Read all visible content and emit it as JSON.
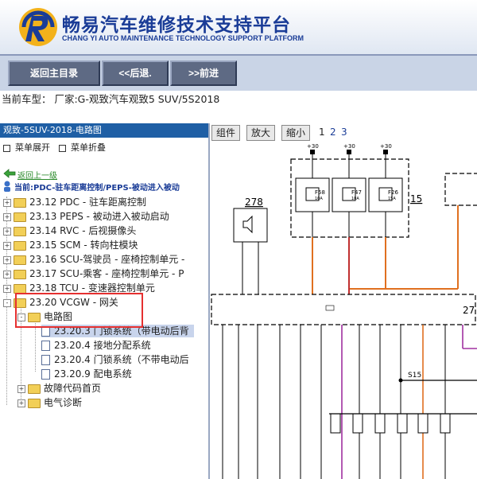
{
  "header": {
    "brand_cn": "畅易汽车维修技术支持平台",
    "brand_en": "CHANG YI AUTO MAINTENANCE TECHNOLOGY SUPPORT PLATFORM"
  },
  "toolbar": {
    "home_label": "返回主目录",
    "back_label": "<<后退.",
    "forward_label": ">>前进"
  },
  "current_vehicle": "当前车型： 厂家:G-观致汽车观致5 SUV/5S2018",
  "left_panel": {
    "title": "观致-5SUV-2018-电路图",
    "expand_label": "菜单展开",
    "collapse_label": "菜单折叠",
    "up_link": "返回上一级",
    "current_path": "当前:PDC-驻车距离控制/PEPS-被动进入被动",
    "tree": [
      {
        "label": "23.12 PDC - 驻车距离控制"
      },
      {
        "label": "23.13 PEPS - 被动进入被动启动"
      },
      {
        "label": "23.14 RVC - 后视摄像头"
      },
      {
        "label": "23.15 SCM - 转向柱模块"
      },
      {
        "label": "23.16 SCU-驾驶员 - 座椅控制单元 -"
      },
      {
        "label": "23.17 SCU-乘客 - 座椅控制单元 - P"
      },
      {
        "label": "23.18 TCU - 变速器控制单元"
      },
      {
        "label": "23.20 VCGW - 网关"
      },
      {
        "label": "电路图"
      },
      {
        "label": "23.20.3 门锁系统（带电动后背"
      },
      {
        "label": "23.20.4 接地分配系统"
      },
      {
        "label": "23.20.4 门锁系统（不带电动后"
      },
      {
        "label": "23.20.9 配电系统"
      },
      {
        "label": "故障代码首页"
      },
      {
        "label": "电气诊断"
      }
    ]
  },
  "diagram_panel": {
    "tab_components": "组件",
    "tab_zoom_in": "放大",
    "tab_zoom_out": "缩小",
    "pages": [
      "1",
      "2",
      "3"
    ],
    "labels": {
      "p30a": "+30",
      "p30b": "+30",
      "p30c": "+30",
      "f58": "F58",
      "f47": "F47",
      "f26": "F26",
      "a10a": "10A",
      "a10b": "10A",
      "a15": "15A",
      "n15": "15",
      "n278": "278",
      "n27": "27",
      "s15": "S15"
    }
  }
}
